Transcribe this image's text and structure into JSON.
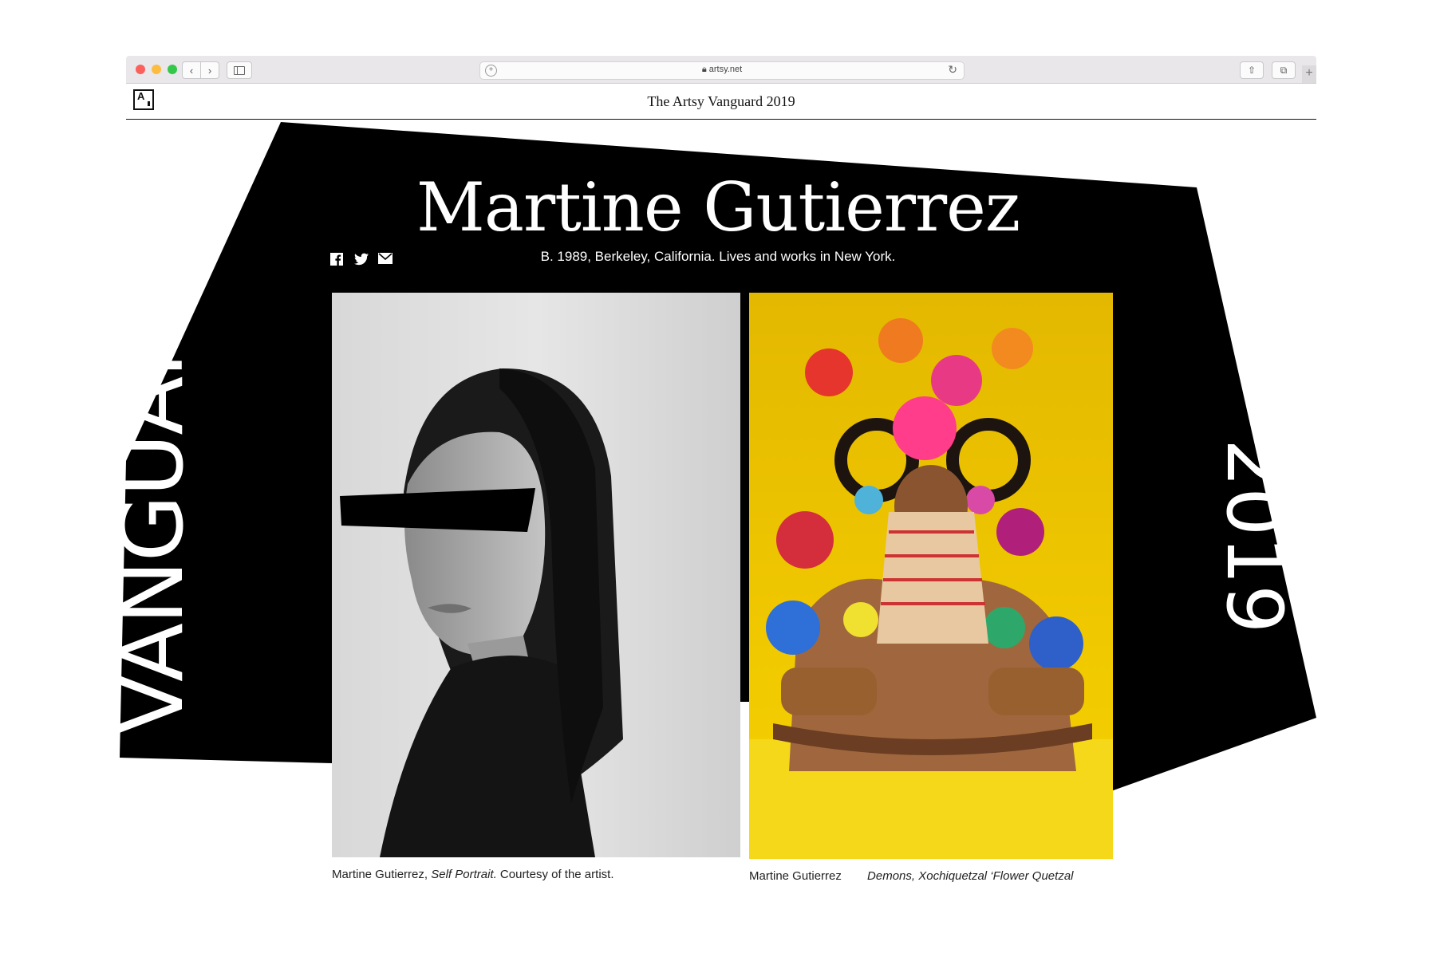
{
  "browser": {
    "url": "artsy.net",
    "back_icon": "‹",
    "forward_icon": "›"
  },
  "header": {
    "logo_text": "A",
    "title": "The Artsy Vanguard 2019"
  },
  "hero": {
    "artist_name": "Martine Gutierrez",
    "bio": "B. 1989, Berkeley, California. Lives and works in New York.",
    "side_left": "VANGUARD",
    "side_right": "2019",
    "share_icons": [
      "facebook-icon",
      "twitter-icon",
      "email-icon"
    ]
  },
  "images": [
    {
      "caption_artist": "Martine Gutierrez,",
      "caption_title": "Self Portrait.",
      "caption_credit": "Courtesy of the artist."
    },
    {
      "caption_artist": "Martine Gutierrez",
      "caption_title": "Demons, Xochiquetzal ‘Flower Quetzal"
    }
  ],
  "colors": {
    "hero_black": "#000000",
    "yellow_backdrop": "#f0c800"
  }
}
